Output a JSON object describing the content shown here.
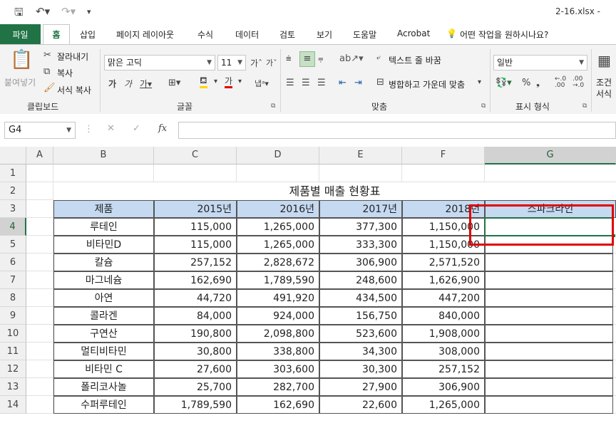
{
  "titlebar": {
    "filename": "2-16.xlsx -"
  },
  "tabs": [
    "파일",
    "홈",
    "삽입",
    "페이지 레이아웃",
    "수식",
    "데이터",
    "검토",
    "보기",
    "도움말",
    "Acrobat"
  ],
  "tell_me": "어떤 작업을 원하시나요?",
  "ribbon": {
    "clipboard": {
      "paste": "붙여넣기",
      "cut": "잘라내기",
      "copy": "복사",
      "format_painter": "서식 복사",
      "label": "클립보드"
    },
    "font": {
      "name": "맑은 고딕",
      "size": "11",
      "label": "글꼴"
    },
    "alignment": {
      "wrap_text": "텍스트 줄 바꿈",
      "merge_center": "병합하고 가운데 맞춤",
      "label": "맞춤"
    },
    "number": {
      "format": "일반",
      "label": "표시 형식"
    },
    "styles": {
      "label1": "조건",
      "label2": "서식"
    }
  },
  "formula_bar": {
    "name_box": "G4",
    "fx": "fx",
    "value": ""
  },
  "columns": [
    "A",
    "B",
    "C",
    "D",
    "E",
    "F",
    "G"
  ],
  "rows": [
    "1",
    "2",
    "3",
    "4",
    "5",
    "6",
    "7",
    "8",
    "9",
    "10",
    "11",
    "12",
    "13",
    "14"
  ],
  "sheet": {
    "title": "제품별 매출 현황표",
    "headers": [
      "제품",
      "2015년",
      "2016년",
      "2017년",
      "2018년",
      "스파크라인"
    ],
    "data": [
      [
        "루테인",
        "115,000",
        "1,265,000",
        "377,300",
        "1,150,000"
      ],
      [
        "비타민D",
        "115,000",
        "1,265,000",
        "333,300",
        "1,150,000"
      ],
      [
        "칼슘",
        "257,152",
        "2,828,672",
        "306,900",
        "2,571,520"
      ],
      [
        "마그네슘",
        "162,690",
        "1,789,590",
        "248,600",
        "1,626,900"
      ],
      [
        "아연",
        "44,720",
        "491,920",
        "434,500",
        "447,200"
      ],
      [
        "콜라겐",
        "84,000",
        "924,000",
        "156,750",
        "840,000"
      ],
      [
        "구연산",
        "190,800",
        "2,098,800",
        "523,600",
        "1,908,000"
      ],
      [
        "멀티비타민",
        "30,800",
        "338,800",
        "34,300",
        "308,000"
      ],
      [
        "비타민 C",
        "27,600",
        "303,600",
        "30,300",
        "257,152"
      ],
      [
        "폴리코사놀",
        "25,700",
        "282,700",
        "27,900",
        "306,900"
      ],
      [
        "수퍼루테인",
        "1,789,590",
        "162,690",
        "22,600",
        "1,265,000"
      ]
    ]
  },
  "colors": {
    "accent": "#217346",
    "header_fill": "#c5d9f1",
    "highlight_box": "#e00000"
  }
}
